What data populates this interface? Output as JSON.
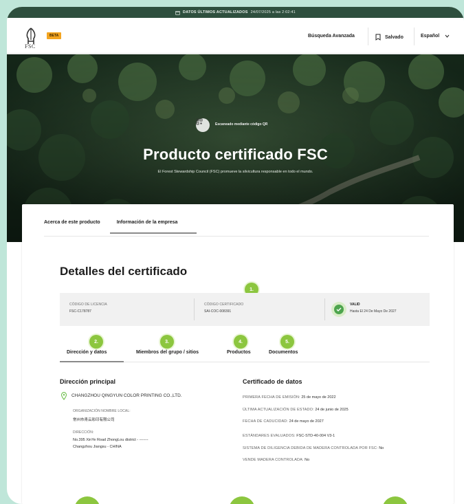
{
  "topbar": {
    "label": "DATOS ÚLTIMOS ACTUALIZADOS",
    "value": "24/07/2025 a las 2:02:41"
  },
  "nav": {
    "logo_text": "FSC",
    "beta": "BETA",
    "advanced_search": "Búsqueda Avanzada",
    "saved": "Salvado",
    "language": "Español"
  },
  "hero": {
    "scan_text": "Escaneado mediante código QR",
    "title": "Producto certificado FSC",
    "subtitle": "El Forest Stewardship Council (FSC) promueve la silvicultura responsable en todo el mundo."
  },
  "tabs": [
    {
      "label": "Acerca de este producto"
    },
    {
      "label": "Información de la empresa"
    }
  ],
  "certificate": {
    "title": "Detalles del certificado",
    "license_label": "CÓDIGO DE LICENCIA",
    "license_value": "FSC-C178787",
    "cert_code_label": "CÓDIGO CERTIFICADO",
    "cert_code_value": "SAI-COC-008391",
    "status_label": "VALID",
    "status_until": "Hasta El 24 De Mayo De 2027"
  },
  "badges": [
    "1.",
    "2.",
    "3.",
    "4.",
    "5."
  ],
  "subtabs": [
    {
      "label": "Dirección y datos"
    },
    {
      "label": "Miembros del grupo / sitios"
    },
    {
      "label": "Productos"
    },
    {
      "label": "Documentos"
    }
  ],
  "address": {
    "heading": "Dirección principal",
    "company": "CHANGZHOU QINGYUN COLOR PRINTING CO.,LTD.",
    "local_name_label": "ORGANIZACIÓN NOMBRE LOCAL:",
    "local_name_value": "常州市青云彩印有限公司",
    "address_label": "DIRECCIÓN:",
    "address_line1": "No.395 XinYe Road ZhongLou district - -------",
    "address_line2": "Changzhou Jiangsu - CHINA"
  },
  "cert_data": {
    "heading": "Certificado de datos",
    "rows": [
      {
        "k": "PRIMERA FECHA DE EMISIÓN:",
        "v": "25 de mayo de 2022"
      },
      {
        "k": "ÚLTIMA ACTUALIZACIÓN DE ESTADO:",
        "v": "24 de junio de 2025"
      },
      {
        "k": "FECHA DE CADUCIDAD:",
        "v": "24 de mayo de 2027"
      },
      {
        "k": "ESTÁNDARES EVALUADOS:",
        "v": "FSC-STD-40-004 V3-1"
      },
      {
        "k": "SISTEMA DE DILIGENCIA DEBIDA DE MADERA CONTROLADA POR FSC:",
        "v": "No"
      },
      {
        "k": "VENDE MADERA CONTROLADA:",
        "v": "No"
      }
    ]
  },
  "colors": {
    "accent_green": "#8cc63f",
    "dark_green": "#2e4f3e",
    "valid_green": "#4ea54e",
    "beta": "#f3a521"
  }
}
